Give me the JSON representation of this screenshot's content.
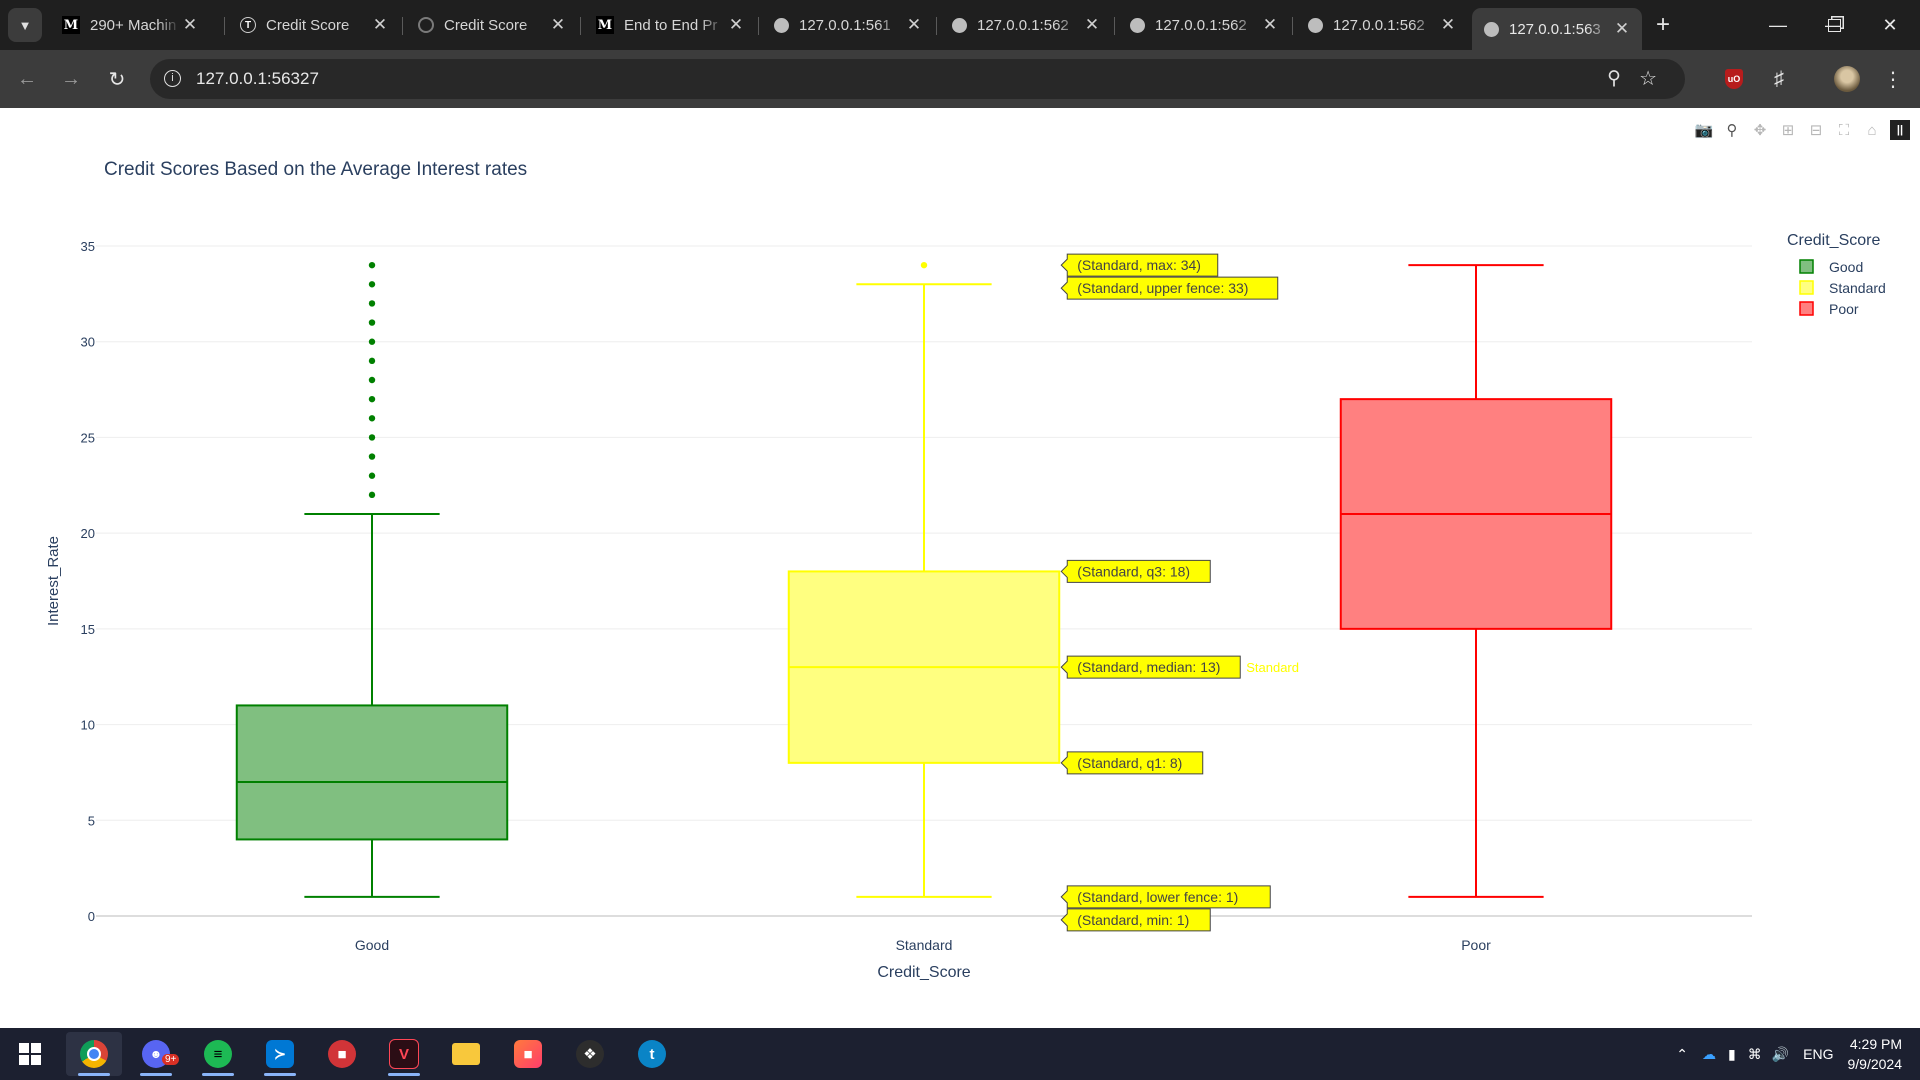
{
  "browser": {
    "tabs": [
      {
        "title": "290+ Machin",
        "icon": "medium-icon",
        "active": false
      },
      {
        "title": "Credit Score",
        "icon": "t-circle-icon",
        "active": false
      },
      {
        "title": "Credit Score",
        "icon": "spinner-icon",
        "active": false
      },
      {
        "title": "End to End Pr",
        "icon": "medium-icon",
        "active": false
      },
      {
        "title": "127.0.0.1:561",
        "icon": "globe-icon",
        "active": false
      },
      {
        "title": "127.0.0.1:562",
        "icon": "globe-icon",
        "active": false
      },
      {
        "title": "127.0.0.1:562",
        "icon": "globe-icon",
        "active": false
      },
      {
        "title": "127.0.0.1:562",
        "icon": "globe-icon",
        "active": false
      },
      {
        "title": "127.0.0.1:563",
        "icon": "globe-icon",
        "active": true
      }
    ],
    "url": "127.0.0.1:56327",
    "accent": "#8ab4f8"
  },
  "chart_data": {
    "type": "box",
    "title": "Credit Scores Based on the Average Interest rates",
    "xlabel": "Credit_Score",
    "ylabel": "Interest_Rate",
    "ylim": [
      0,
      35
    ],
    "yticks": [
      0,
      5,
      10,
      15,
      20,
      25,
      30,
      35
    ],
    "grid": true,
    "legend_title": "Credit_Score",
    "legend_position": "top-right",
    "categories": [
      "Good",
      "Standard",
      "Poor"
    ],
    "series": [
      {
        "name": "Good",
        "color": "#008000",
        "fill": "#80bf80",
        "min": 1,
        "lower_fence": 1,
        "q1": 4,
        "median": 7,
        "q3": 11,
        "upper_fence": 21,
        "max": 34,
        "outliers": [
          22,
          23,
          24,
          25,
          26,
          27,
          28,
          29,
          30,
          31,
          32,
          33,
          34
        ]
      },
      {
        "name": "Standard",
        "color": "#ffff00",
        "fill": "#ffff80",
        "min": 1,
        "lower_fence": 1,
        "q1": 8,
        "median": 13,
        "q3": 18,
        "upper_fence": 33,
        "max": 34,
        "outliers": [
          34
        ]
      },
      {
        "name": "Poor",
        "color": "#ff0000",
        "fill": "#ff8080",
        "min": 1,
        "lower_fence": 1,
        "q1": 15,
        "median": 21,
        "q3": 27,
        "upper_fence": 34,
        "max": 34,
        "outliers": []
      }
    ],
    "hover": {
      "series": "Standard",
      "labels": [
        {
          "text": "(Standard, max: 34)",
          "value": 34
        },
        {
          "text": "(Standard, upper fence: 33)",
          "value": 33
        },
        {
          "text": "(Standard, q3: 18)",
          "value": 18
        },
        {
          "text": "(Standard, median: 13)",
          "value": 13
        },
        {
          "text": "(Standard, q1: 8)",
          "value": 8
        },
        {
          "text": "(Standard, lower fence: 1)",
          "value": 1
        },
        {
          "text": "(Standard, min: 1)",
          "value": 1
        }
      ],
      "trace_label": "Standard"
    }
  },
  "taskbar": {
    "apps": [
      "start-icon",
      "chrome-icon",
      "discord-icon",
      "spotify-icon",
      "vscode-icon",
      "office-icon",
      "valorant-icon",
      "file-explorer-icon",
      "box-app-icon",
      "mouse-app-icon",
      "edge-icon"
    ],
    "discord_badge": "9+",
    "language": "ENG",
    "time": "4:29 PM",
    "date": "9/9/2024"
  }
}
